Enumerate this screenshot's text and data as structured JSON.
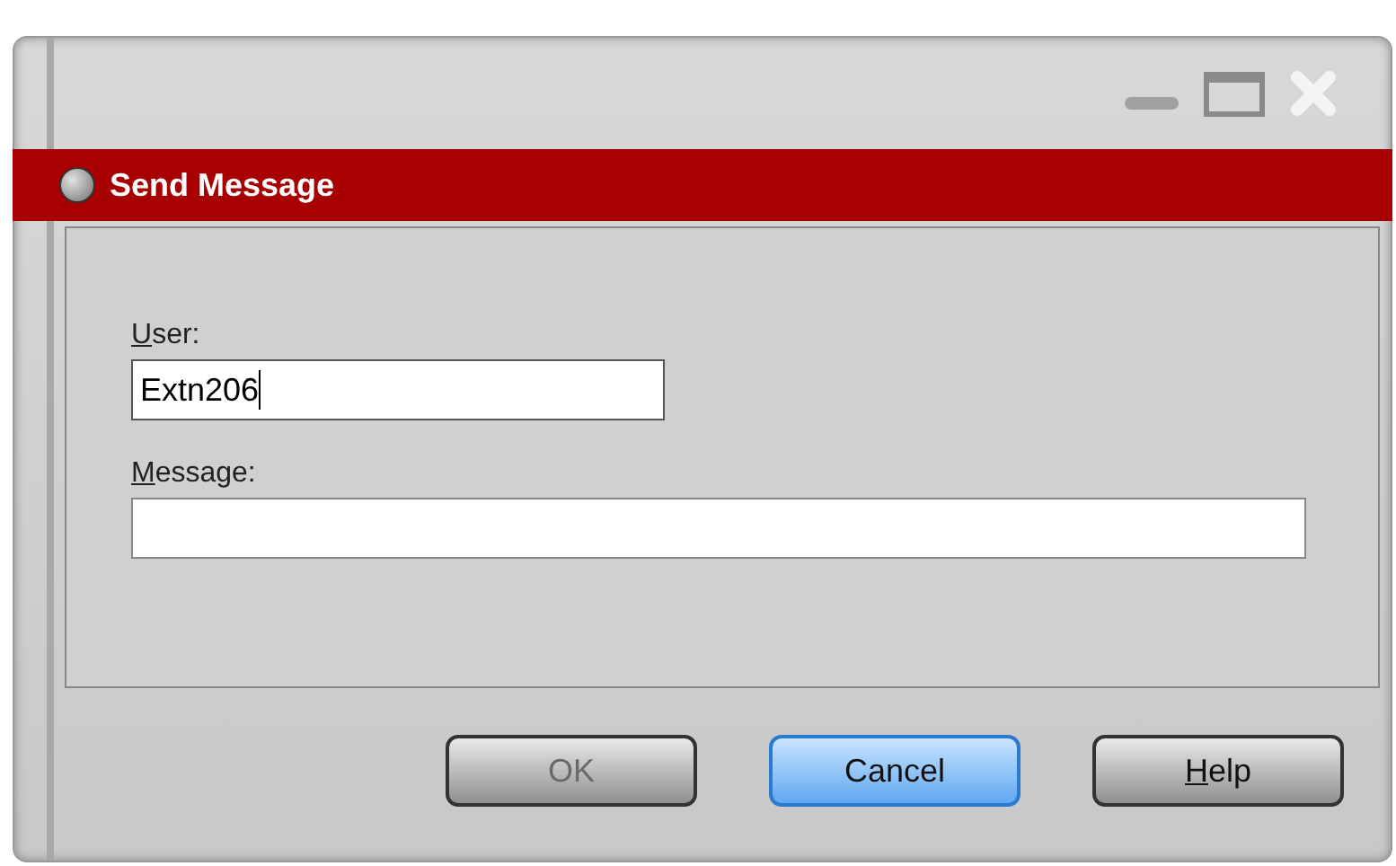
{
  "window": {
    "title": "Send Message"
  },
  "fields": [
    {
      "mnemonic": "U",
      "label_rest": "ser:",
      "value": "Extn206",
      "focused": true,
      "kind": "short"
    },
    {
      "mnemonic": "M",
      "label_rest": "essage:",
      "focused": false,
      "kind": "wide"
    }
  ],
  "buttons": [
    {
      "label_rest": "OK",
      "disabled": true,
      "default": false
    },
    {
      "label_rest": "Cancel",
      "disabled": false,
      "default": true
    },
    {
      "mnemonic": "H",
      "label_rest": "elp",
      "disabled": false,
      "default": false
    }
  ]
}
